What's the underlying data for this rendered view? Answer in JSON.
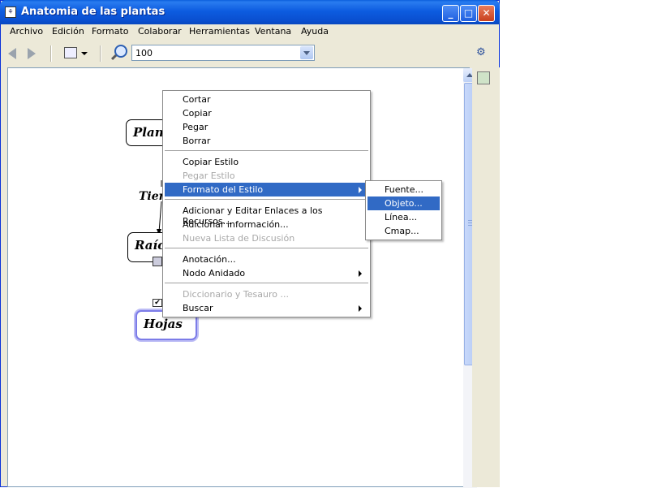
{
  "window": {
    "title": "Anatomia de las plantas",
    "controls": {
      "minimize": "_",
      "maximize": "□",
      "close": "✕"
    }
  },
  "menubar": [
    "Archivo",
    "Edición",
    "Formato",
    "Colaborar",
    "Herramientas",
    "Ventana",
    "Ayuda"
  ],
  "toolbar": {
    "zoom_value": "100"
  },
  "concept_map": {
    "nodes": [
      "Plan",
      "Raíc",
      "Hojas"
    ],
    "link_label": "Tier"
  },
  "context_menu": {
    "groups": [
      [
        {
          "label": "Cortar",
          "enabled": true
        },
        {
          "label": "Copiar",
          "enabled": true
        },
        {
          "label": "Pegar",
          "enabled": true
        },
        {
          "label": "Borrar",
          "enabled": true
        }
      ],
      [
        {
          "label": "Copiar Estilo",
          "enabled": true
        },
        {
          "label": "Pegar Estilo",
          "enabled": false
        },
        {
          "label": "Formato del Estilo",
          "enabled": true,
          "submenu": true,
          "highlighted": true
        }
      ],
      [
        {
          "label": "Adicionar y Editar Enlaces a los Recursos...",
          "enabled": true
        },
        {
          "label": "Adicionar información...",
          "enabled": true
        },
        {
          "label": "Nueva Lista de Discusión",
          "enabled": false
        }
      ],
      [
        {
          "label": "Anotación...",
          "enabled": true
        },
        {
          "label": "Nodo Anidado",
          "enabled": true,
          "submenu": true
        }
      ],
      [
        {
          "label": "Diccionario y Tesauro ...",
          "enabled": false
        },
        {
          "label": "Buscar",
          "enabled": true,
          "submenu": true
        }
      ]
    ]
  },
  "submenu": {
    "items": [
      "Fuente...",
      "Objeto...",
      "Línea...",
      "Cmap..."
    ],
    "highlighted_index": 1
  },
  "colors": {
    "titlebar": "#0a5fdc",
    "menu_highlight": "#316ac5",
    "window_bg": "#ece9d8"
  }
}
